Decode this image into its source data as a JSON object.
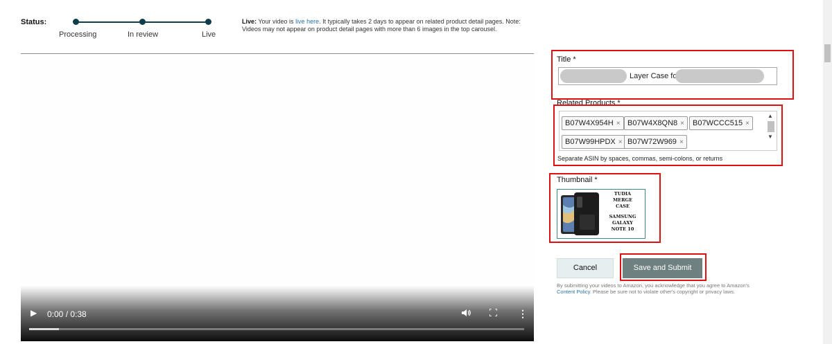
{
  "status": {
    "label": "Status:",
    "steps": [
      "Processing",
      "In review",
      "Live"
    ],
    "note_bold": "Live:",
    "note_pre": " Your video is ",
    "note_link": "live here",
    "note_post": ". It typically takes 2 days to appear on related product detail pages. Note: Videos may not appear on product detail pages with more than 6 images in the top carousel."
  },
  "video": {
    "time": "0:00 / 0:38",
    "progress": 0.06,
    "icons": [
      "play-icon",
      "volume-icon",
      "fullscreen-icon",
      "more-options-icon"
    ]
  },
  "form": {
    "title_label": "Title *",
    "title_value": "Layer Case for",
    "related_label": "Related Products *",
    "asins": [
      "B07W4X954H",
      "B07W4X8QN8",
      "B07WCCC515",
      "B07W99HPDX",
      "B07W72W969"
    ],
    "asin_hint": "Separate ASIN by spaces, commas, semi-colons, or returns",
    "thumbnail_label": "Thumbnail *",
    "thumbnail_text": [
      "TUDIA",
      "MERGE",
      "CASE",
      "",
      "SAMSUNG",
      "GALAXY",
      "NOTE 10"
    ],
    "cancel_label": "Cancel",
    "submit_label": "Save and Submit",
    "terms_pre": "By submitting your videos to Amazon, you acknowledge that you agree to Amazon's",
    "terms_link": "Content Policy",
    "terms_post": ". Please be sure not to violate other's copyright or privacy laws."
  },
  "colors": {
    "accent": "#0f3d4a",
    "highlight": "#e01010",
    "submit_bg": "#6e8080",
    "link": "#2a73a8"
  }
}
